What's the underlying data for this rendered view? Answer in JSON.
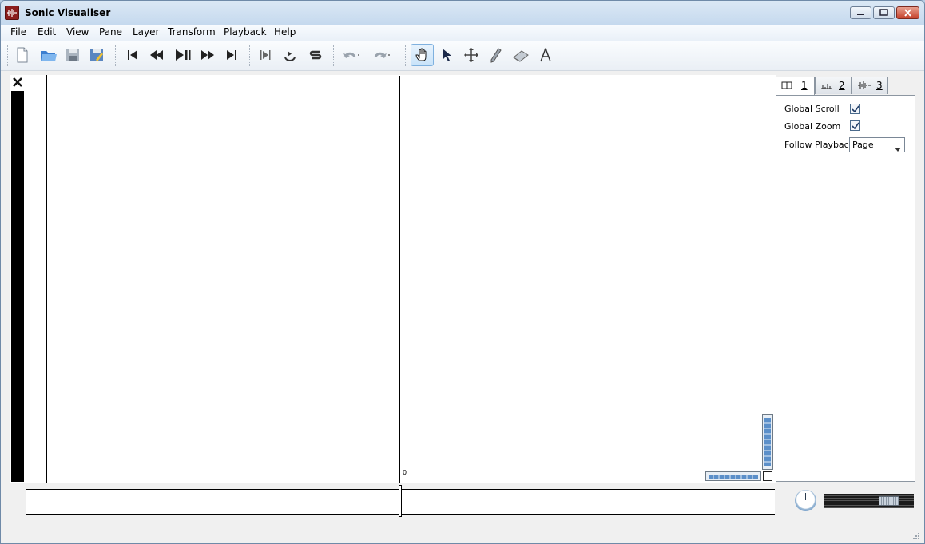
{
  "window": {
    "title": "Sonic Visualiser"
  },
  "menu": [
    "File",
    "Edit",
    "View",
    "Pane",
    "Layer",
    "Transform",
    "Playback",
    "Help"
  ],
  "toolbar": {
    "icons": [
      "new-document-icon",
      "open-folder-icon",
      "save-icon",
      "save-as-icon",
      "rewind-start-icon",
      "rewind-icon",
      "play-pause-icon",
      "fast-forward-icon",
      "fast-forward-end-icon",
      "play-selection-icon",
      "loop-icon",
      "solo-icon",
      "undo-icon",
      "redo-icon",
      "navigate-hand-icon",
      "select-arrow-icon",
      "move-icon",
      "draw-pencil-icon",
      "erase-icon",
      "measure-icon"
    ],
    "active_tool": "navigate"
  },
  "pane": {
    "ruler_zero": "0"
  },
  "properties": {
    "tabs": [
      {
        "number": "1",
        "icon": "pane-icon"
      },
      {
        "number": "2",
        "icon": "ruler-icon"
      },
      {
        "number": "3",
        "icon": "waveform-icon"
      }
    ],
    "global_scroll_label": "Global Scroll",
    "global_scroll_checked": true,
    "global_zoom_label": "Global Zoom",
    "global_zoom_checked": true,
    "follow_playback_label": "Follow Playback",
    "follow_playback_value": "Page"
  },
  "colors": {
    "accent": "#3b78b8",
    "pane_bg": "#ffffff",
    "title_bg": "#c5d9ee"
  }
}
